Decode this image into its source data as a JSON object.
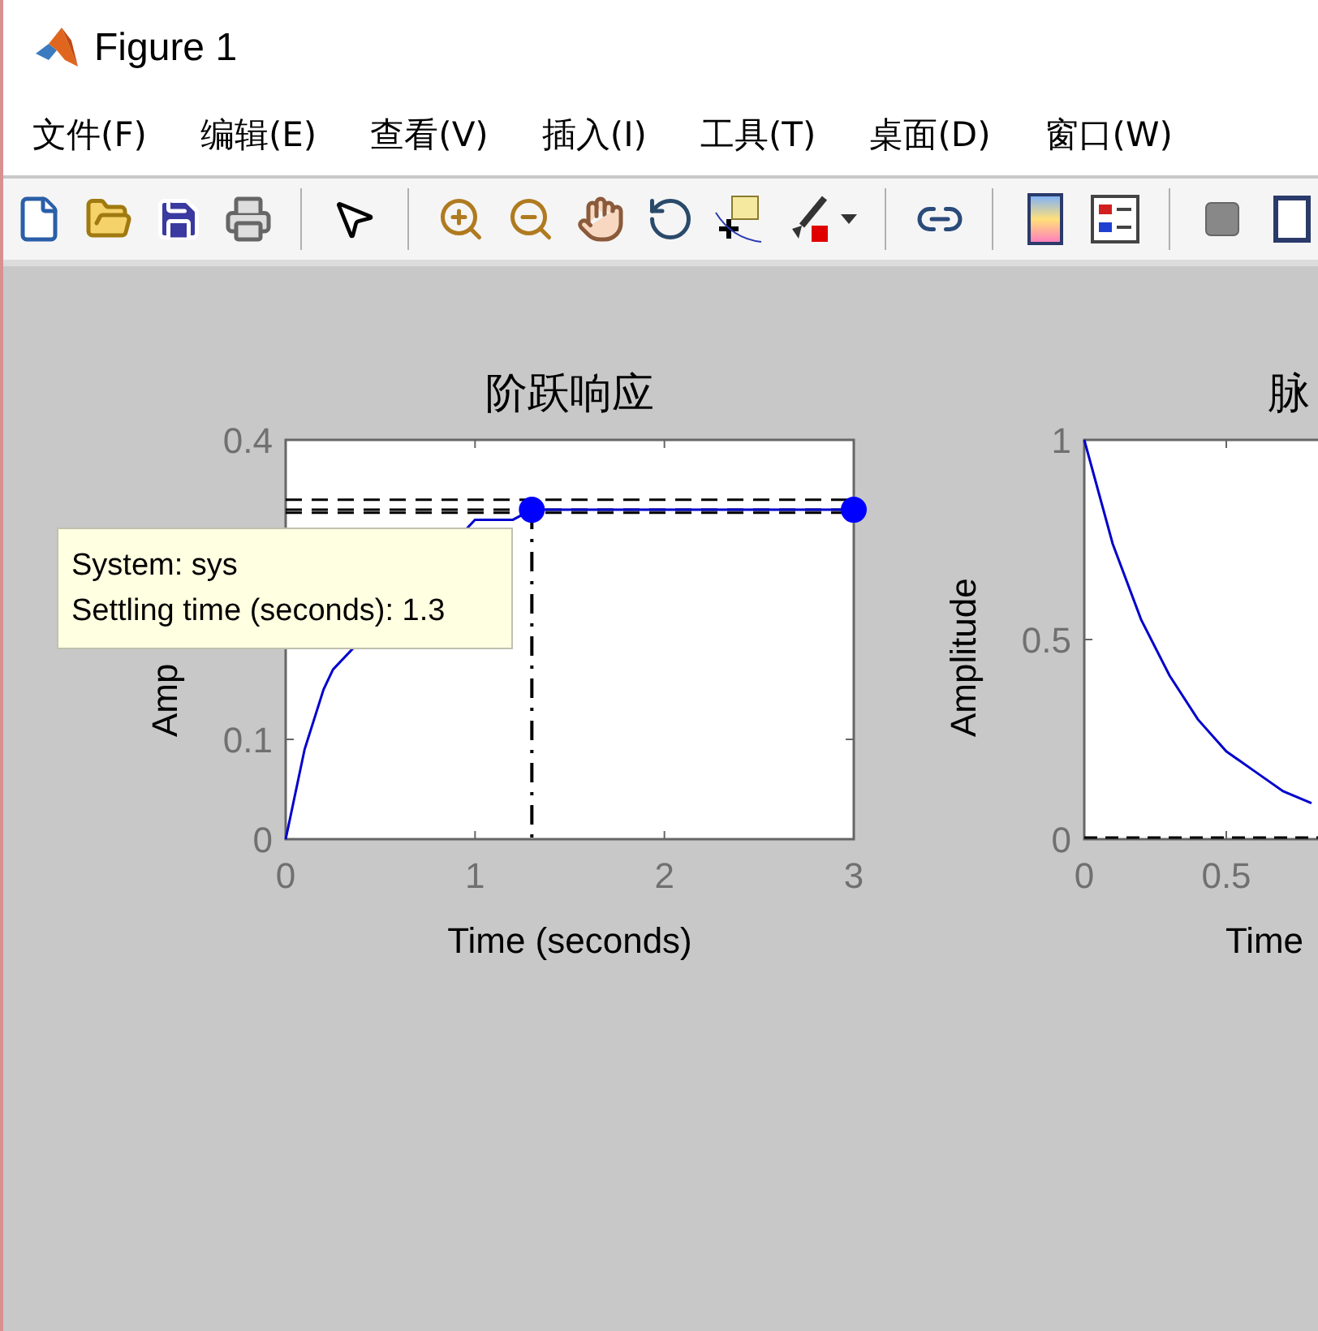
{
  "window": {
    "title": "Figure 1"
  },
  "menu": [
    "文件(F)",
    "编辑(E)",
    "查看(V)",
    "插入(I)",
    "工具(T)",
    "桌面(D)",
    "窗口(W)"
  ],
  "plots": [
    {
      "chart_data": {
        "type": "line",
        "title": "阶跃响应",
        "xlabel": "Time (seconds)",
        "ylabel": "Amp",
        "xlim": [
          0,
          3
        ],
        "ylim": [
          0,
          0.4
        ],
        "xticks": [
          0,
          1,
          2,
          3
        ],
        "yticks": [
          0,
          0.1,
          0.4
        ],
        "x": [
          0,
          0.1,
          0.2,
          0.25,
          1.0,
          1.1,
          1.2,
          1.3,
          1.5,
          2,
          2.5,
          3
        ],
        "series": [
          {
            "color": "#0000cc",
            "values": [
              0,
              0.09,
              0.15,
              0.17,
              0.32,
              0.32,
              0.32,
              0.33,
              0.33,
              0.33,
              0.33,
              0.33
            ]
          }
        ],
        "ref_lines": [
          {
            "axis": "y",
            "value": 0.33
          },
          {
            "axis": "y",
            "value": 0.34
          },
          {
            "axis": "y",
            "value": 0.327
          },
          {
            "axis": "x",
            "value": 1.3
          }
        ]
      },
      "tooltip": [
        "System: sys",
        "Settling time (seconds): 1.3"
      ]
    },
    {
      "chart_data": {
        "type": "line",
        "title": "脉",
        "xlabel": "Time",
        "ylabel": "Amplitude",
        "xlim": [
          0,
          2
        ],
        "ylim": [
          0,
          1
        ],
        "xticks": [
          0,
          0.5
        ],
        "yticks": [
          0,
          0.5,
          1
        ],
        "x": [
          0,
          0.1,
          0.2,
          0.3,
          0.4,
          0.5,
          0.6,
          0.7,
          0.8
        ],
        "series": [
          {
            "color": "#0000cc",
            "values": [
              1,
              0.74,
              0.55,
              0.41,
              0.3,
              0.22,
              0.17,
              0.12,
              0.09
            ]
          }
        ],
        "ref_lines": [
          {
            "axis": "y",
            "value": 0
          }
        ]
      }
    }
  ]
}
